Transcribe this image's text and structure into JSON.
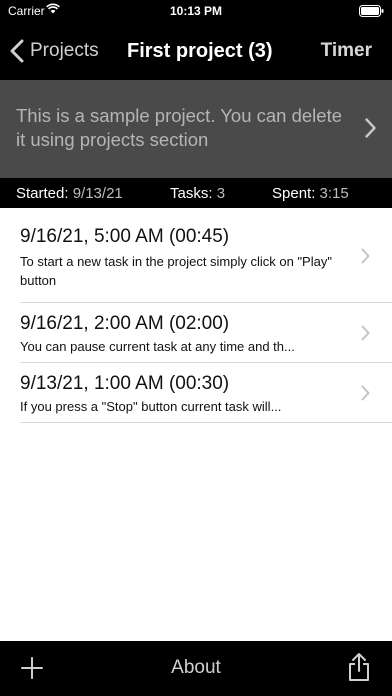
{
  "status_bar": {
    "carrier": "Carrier",
    "time": "10:13 PM",
    "icons": [
      "wifi-icon",
      "battery-icon"
    ]
  },
  "nav": {
    "back_label": "Projects",
    "title": "First project (3)",
    "right_label": "Timer"
  },
  "description": {
    "text": "This is a sample project. You can delete it using projects section"
  },
  "stats": {
    "started_label": "Started:",
    "started_value": "9/13/21",
    "tasks_label": "Tasks:",
    "tasks_value": "3",
    "spent_label": "Spent:",
    "spent_value": "3:15"
  },
  "tasks": [
    {
      "title": "9/16/21, 5:00 AM (00:45)",
      "subtitle": "To start a new task in the project simply click on \"Play\" button"
    },
    {
      "title": "9/16/21, 2:00 AM (02:00)",
      "subtitle": "You can pause current task at any time and th..."
    },
    {
      "title": "9/13/21, 1:00 AM (00:30)",
      "subtitle": "If you press a \"Stop\" button current task will..."
    }
  ],
  "toolbar": {
    "about_label": "About"
  },
  "colors": {
    "nav_background": "#000000",
    "description_background": "#4a4a4a",
    "list_background": "#ffffff"
  }
}
